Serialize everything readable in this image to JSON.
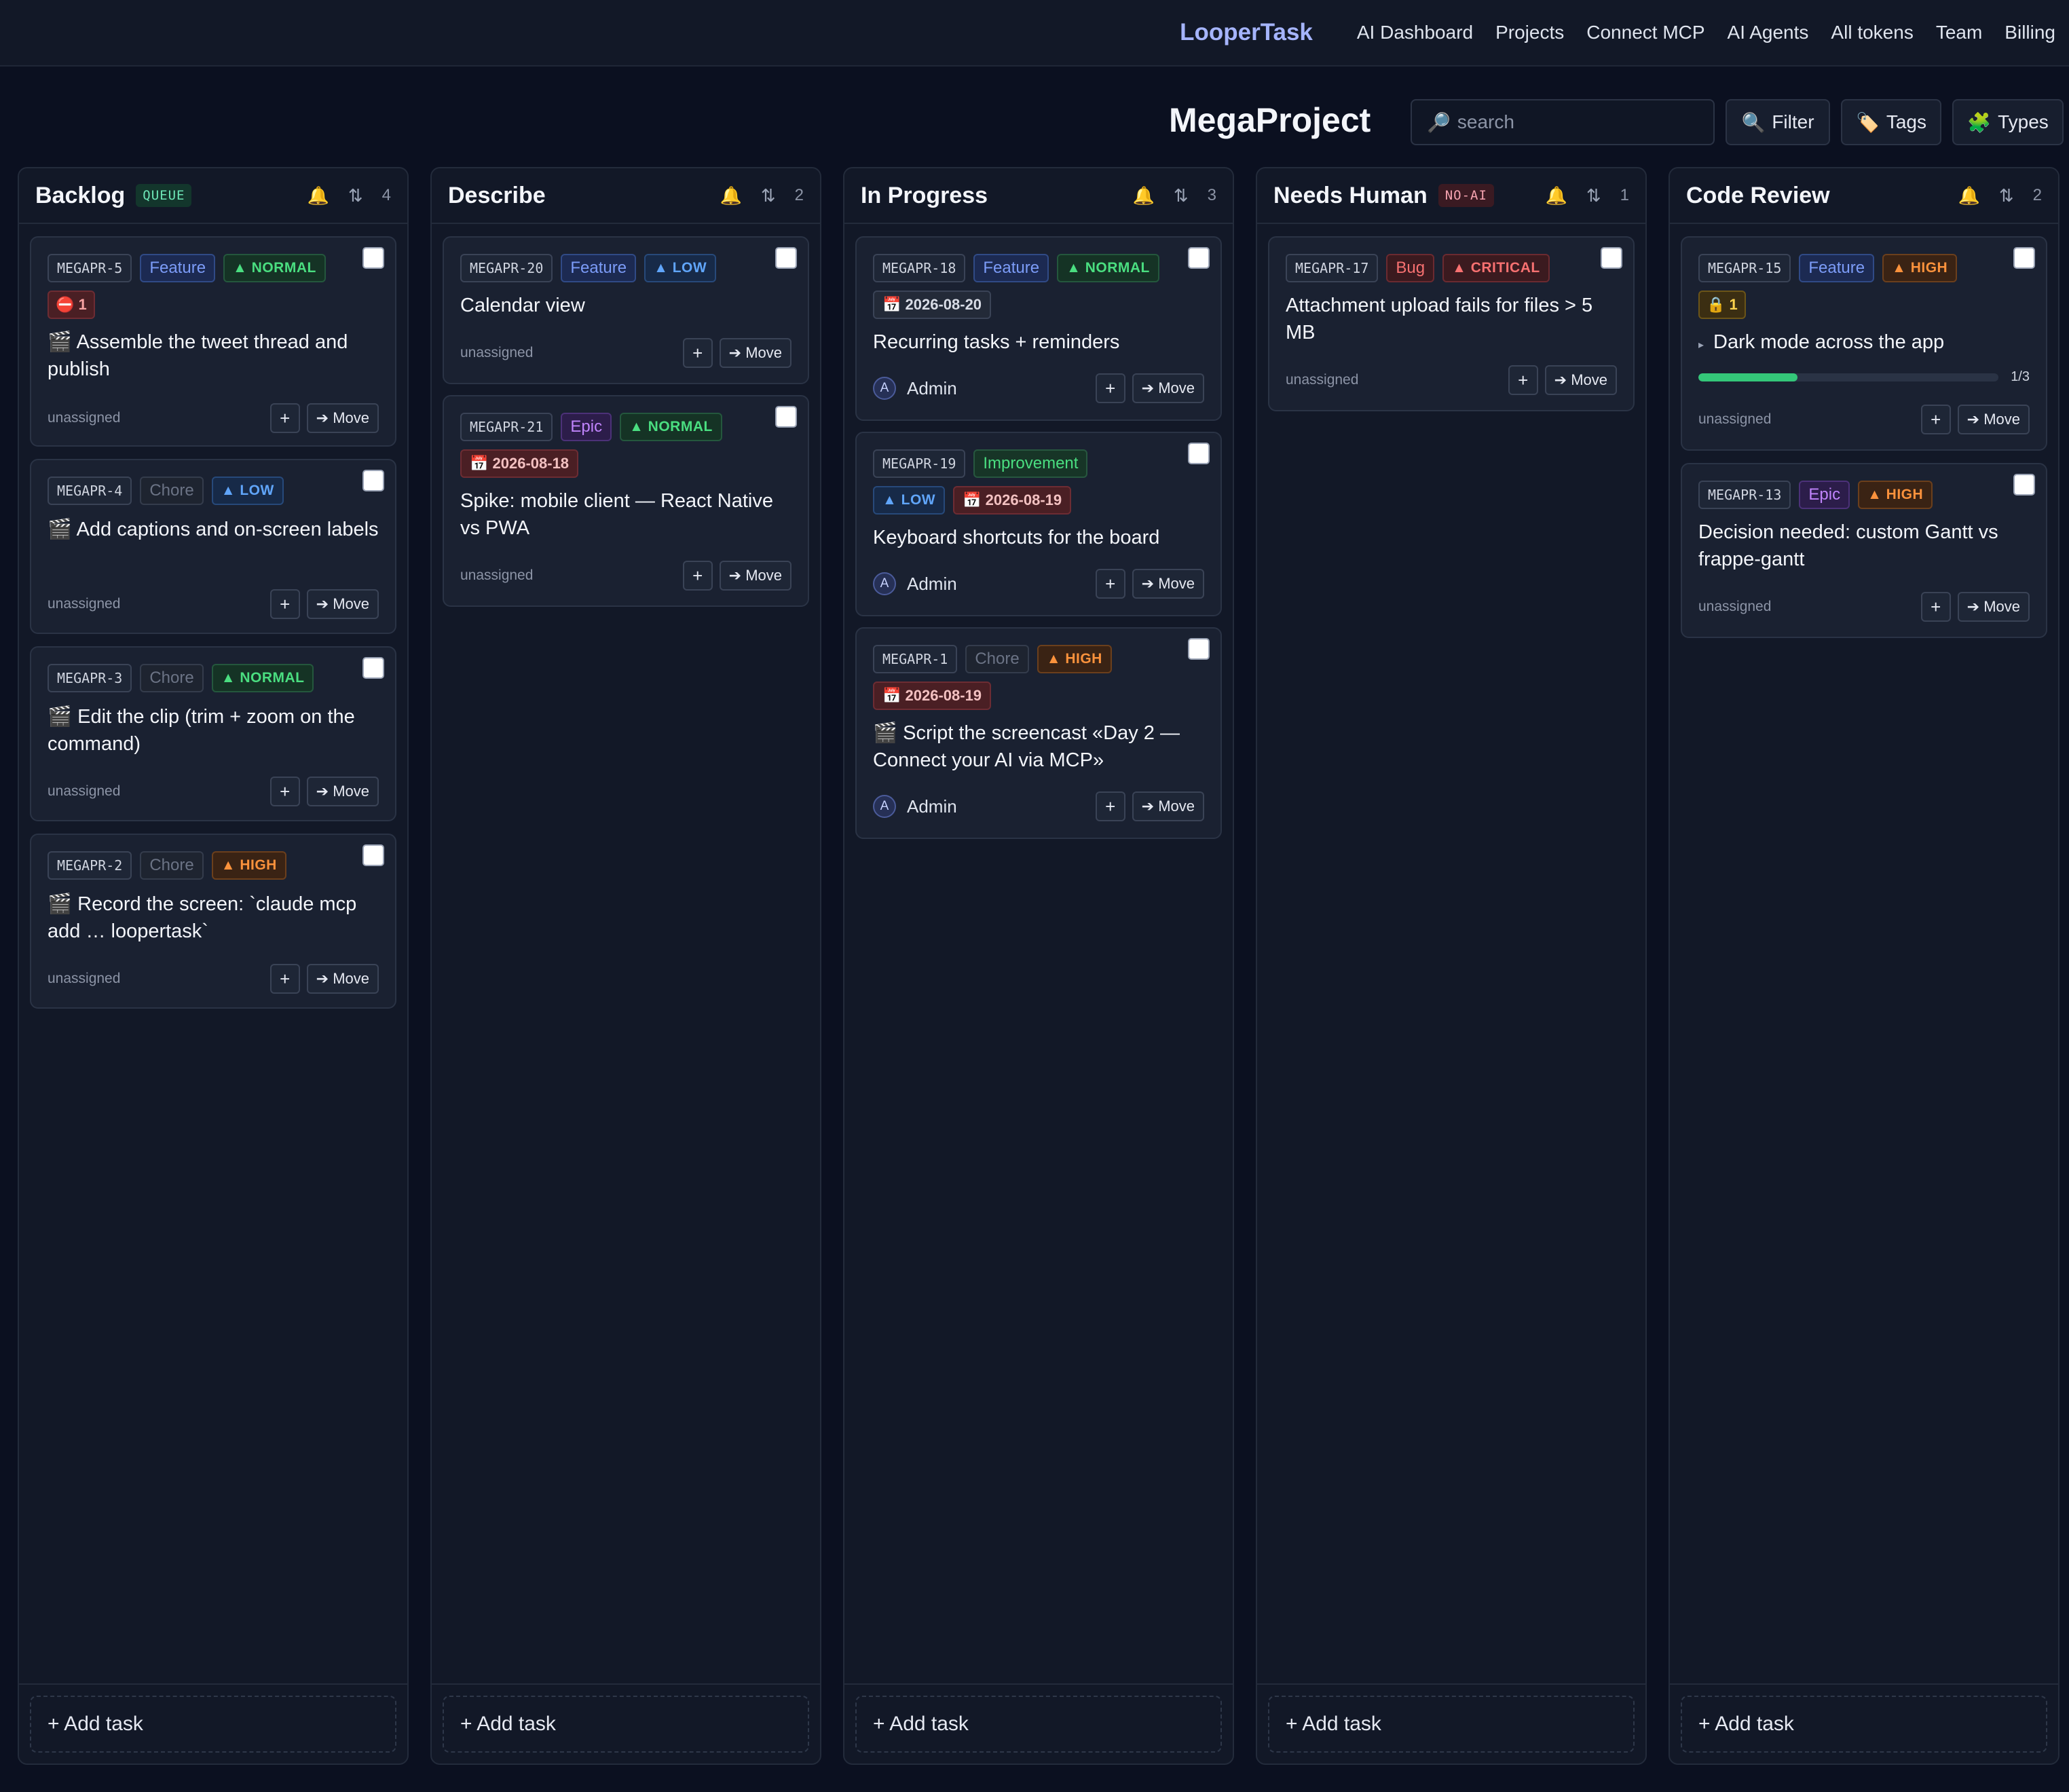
{
  "nav": {
    "brand": "LooperTask",
    "links": [
      "AI Dashboard",
      "Projects",
      "Connect MCP",
      "AI Agents",
      "All tokens",
      "Team",
      "Billing"
    ]
  },
  "header": {
    "project_title": "MegaProject",
    "search_placeholder": "search",
    "filter_label": "Filter",
    "tags_label": "Tags",
    "types_label": "Types"
  },
  "icons": {
    "search": "🔎",
    "filter": "🔍",
    "tags": "🏷️",
    "types": "🧩",
    "bell": "🔔",
    "sort": "⇅",
    "calendar": "📅",
    "clapper": "🎬",
    "stop": "⛔",
    "lock": "🔒",
    "chevron": "▸",
    "arrow": "➔"
  },
  "colors": {
    "accent": "#a5b4fc",
    "background": "#0b1020",
    "progress": "#34c779"
  },
  "add_task_label": "+ Add task",
  "columns": [
    {
      "title": "Backlog",
      "badge": "QUEUE",
      "count": "4",
      "cards": [
        {
          "id": "MEGAPR-5",
          "type": "Feature",
          "priority": "▲ NORMAL",
          "counter": "⛔ 1",
          "title": "🎬 Assemble the tweet thread and publish",
          "assignee": "unassigned",
          "move": "➔ Move",
          "plus": "+"
        },
        {
          "id": "MEGAPR-4",
          "type": "Chore",
          "priority": "▲ LOW",
          "title": "🎬 Add captions and on-screen labels",
          "assignee": "unassigned",
          "move": "➔ Move",
          "plus": "+"
        },
        {
          "id": "MEGAPR-3",
          "type": "Chore",
          "priority": "▲ NORMAL",
          "title": "🎬 Edit the clip (trim + zoom on the command)",
          "assignee": "unassigned",
          "move": "➔ Move",
          "plus": "+"
        },
        {
          "id": "MEGAPR-2",
          "type": "Chore",
          "priority": "▲ HIGH",
          "title": "🎬 Record the screen: `claude mcp add … loopertask`",
          "assignee": "unassigned",
          "move": "➔ Move",
          "plus": "+"
        }
      ]
    },
    {
      "title": "Describe",
      "badge": "",
      "count": "2",
      "cards": [
        {
          "id": "MEGAPR-20",
          "type": "Feature",
          "priority": "▲ LOW",
          "title": "Calendar view",
          "assignee": "unassigned",
          "move": "➔ Move",
          "plus": "+"
        },
        {
          "id": "MEGAPR-21",
          "type": "Epic",
          "priority": "▲ NORMAL",
          "date": "📅 2026-08-18",
          "title": "Spike: mobile client — React Native vs PWA",
          "assignee": "unassigned",
          "move": "➔ Move",
          "plus": "+"
        }
      ]
    },
    {
      "title": "In Progress",
      "badge": "",
      "count": "3",
      "cards": [
        {
          "id": "MEGAPR-18",
          "type": "Feature",
          "priority": "▲ NORMAL",
          "date": "📅 2026-08-20",
          "title": "Recurring tasks + reminders",
          "assignee": "Admin",
          "avatar": "A",
          "move": "➔ Move",
          "plus": "+"
        },
        {
          "id": "MEGAPR-19",
          "type": "Improvement",
          "priority": "▲ LOW",
          "date": "📅 2026-08-19",
          "title": "Keyboard shortcuts for the board",
          "assignee": "Admin",
          "avatar": "A",
          "move": "➔ Move",
          "plus": "+"
        },
        {
          "id": "MEGAPR-1",
          "type": "Chore",
          "priority": "▲ HIGH",
          "date": "📅 2026-08-19",
          "title": "🎬 Script the screencast «Day 2 — Connect your AI via MCP»",
          "assignee": "Admin",
          "avatar": "A",
          "move": "➔ Move",
          "plus": "+"
        }
      ]
    },
    {
      "title": "Needs Human",
      "badge": "NO-AI",
      "count": "1",
      "cards": [
        {
          "id": "MEGAPR-17",
          "type": "Bug",
          "priority": "▲ CRITICAL",
          "title": "Attachment upload fails for files > 5 MB",
          "assignee": "unassigned",
          "move": "➔ Move",
          "plus": "+"
        }
      ]
    },
    {
      "title": "Code Review",
      "badge": "",
      "count": "2",
      "cards": [
        {
          "id": "MEGAPR-15",
          "type": "Feature",
          "priority": "▲ HIGH",
          "counter": "🔒 1",
          "title": "Dark mode across the app",
          "subtasks": "1/3",
          "progress": 0.33,
          "assignee": "unassigned",
          "move": "➔ Move",
          "plus": "+"
        },
        {
          "id": "MEGAPR-13",
          "type": "Epic",
          "priority": "▲ HIGH",
          "title": "Decision needed: custom Gantt vs frappe-gantt",
          "assignee": "unassigned",
          "move": "➔ Move",
          "plus": "+"
        }
      ]
    }
  ]
}
